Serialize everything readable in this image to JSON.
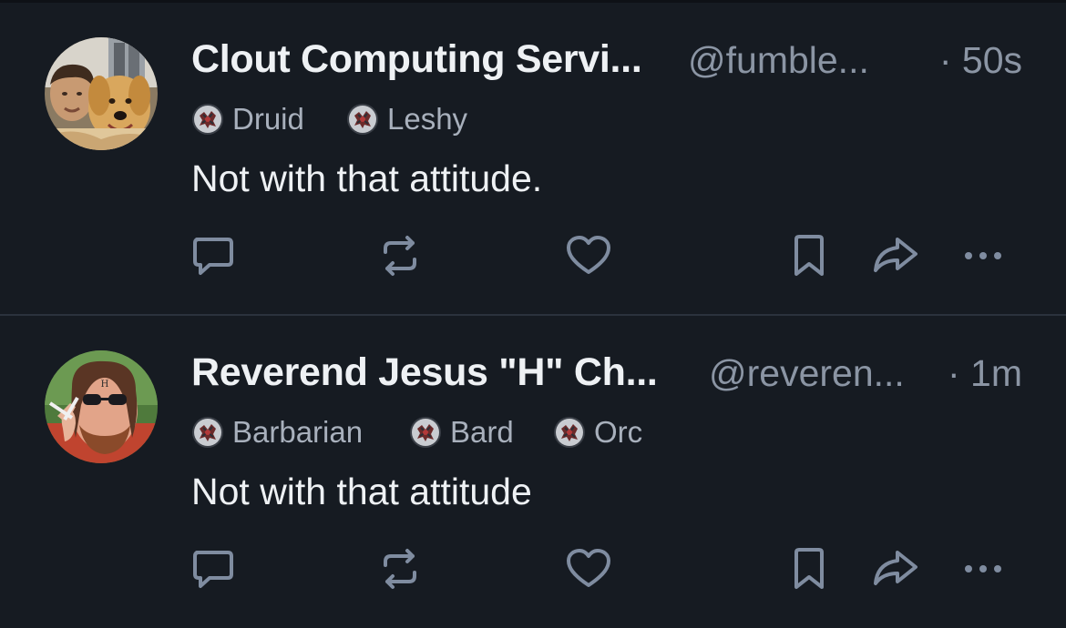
{
  "posts": [
    {
      "author": {
        "display_name": "Clout Computing Servi...",
        "handle": "@fumble...",
        "avatar_icon": "avatar-man-with-dog"
      },
      "timestamp": "· 50s",
      "badges": [
        {
          "label": "Druid",
          "icon": "badge-emblem-icon"
        },
        {
          "label": "Leshy",
          "icon": "badge-emblem-icon"
        }
      ],
      "text": "Not with that attitude.",
      "actions": {
        "reply": "reply-icon",
        "repost": "repost-icon",
        "like": "heart-icon",
        "bookmark": "bookmark-icon",
        "share": "share-icon",
        "more": "more-options-icon"
      }
    },
    {
      "author": {
        "display_name": "Reverend Jesus \"H\" Ch...",
        "handle": "@reveren...",
        "avatar_icon": "avatar-bearded-man-sunglasses"
      },
      "timestamp": "· 1m",
      "badges": [
        {
          "label": "Barbarian",
          "icon": "badge-emblem-icon"
        },
        {
          "label": "Bard",
          "icon": "badge-emblem-icon"
        },
        {
          "label": "Orc",
          "icon": "badge-emblem-icon"
        }
      ],
      "text": "Not with that attitude",
      "actions": {
        "reply": "reply-icon",
        "repost": "repost-icon",
        "like": "heart-icon",
        "bookmark": "bookmark-icon",
        "share": "share-icon",
        "more": "more-options-icon"
      }
    }
  ],
  "colors": {
    "background": "#161b22",
    "primary_text": "#eef1f4",
    "secondary_text": "#8b95a4",
    "badge_text": "#a8b0bc",
    "action_icon": "#7f8ca0",
    "divider": "#2b323d"
  }
}
